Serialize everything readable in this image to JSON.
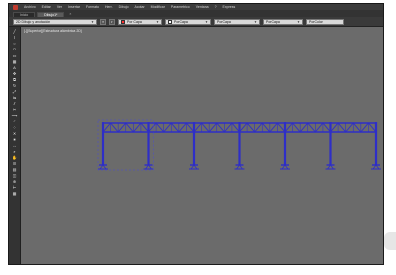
{
  "menubar": {
    "items": [
      "Archivo",
      "Editar",
      "Ver",
      "Insertar",
      "Formato",
      "Herr.",
      "Dibujo",
      "Acotar",
      "Modificar",
      "Parametrico",
      "Ventana",
      "?",
      "Express"
    ]
  },
  "tabs": [
    {
      "label": "Inicio"
    },
    {
      "label": "Dibujo1*"
    }
  ],
  "toolbar": {
    "workspace_combo": "2D Dibujo y anotación",
    "layer_combo": "Por Capa",
    "color_combo": "PorCapa",
    "linetype_combo": "PorCapa",
    "lineweight_combo": "PorCapa",
    "plotstyle_combo": "PorColor"
  },
  "viewport": {
    "label": "[-][Superior][Estructura alámbrica 2D]"
  },
  "colors": {
    "structure": "#2e2ec8",
    "viewport_bg": "#6b6b6b",
    "chrome": "#2b2b2b"
  },
  "lefttools": [
    "line-icon",
    "polyline-icon",
    "circle-icon",
    "arc-icon",
    "rectangle-icon",
    "hatch-icon",
    "text-icon",
    "move-icon",
    "copy-icon",
    "rotate-icon",
    "scale-icon",
    "mirror-icon",
    "offset-icon",
    "trim-icon",
    "extend-icon",
    "fillet-icon",
    "array-icon",
    "erase-icon",
    "explode-icon",
    "dimension-icon",
    "zoom-icon",
    "pan-icon",
    "layer-icon",
    "properties-icon",
    "block-icon",
    "insert-icon",
    "measure-icon",
    "table-icon"
  ]
}
